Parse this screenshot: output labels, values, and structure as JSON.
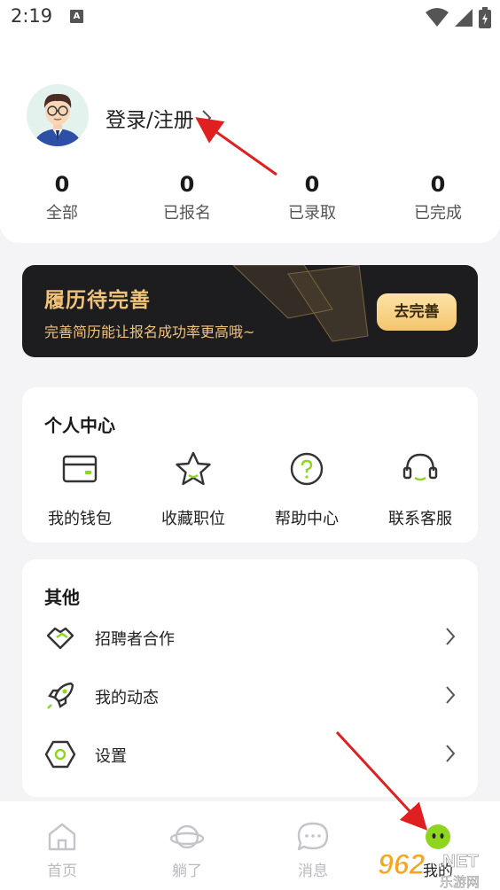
{
  "status_bar": {
    "time": "2:19",
    "app_badge": "A"
  },
  "profile": {
    "login_label": "登录/注册",
    "stats": [
      {
        "value": "0",
        "label": "全部"
      },
      {
        "value": "0",
        "label": "已报名"
      },
      {
        "value": "0",
        "label": "已录取"
      },
      {
        "value": "0",
        "label": "已完成"
      }
    ]
  },
  "resume_banner": {
    "title": "履历待完善",
    "subtitle": "完善简历能让报名成功率更高哦~",
    "button": "去完善"
  },
  "personal_center": {
    "heading": "个人中心",
    "items": [
      {
        "label": "我的钱包",
        "icon": "wallet-icon"
      },
      {
        "label": "收藏职位",
        "icon": "star-icon"
      },
      {
        "label": "帮助中心",
        "icon": "help-icon"
      },
      {
        "label": "联系客服",
        "icon": "headset-icon"
      }
    ]
  },
  "other": {
    "heading": "其他",
    "items": [
      {
        "label": "招聘者合作",
        "icon": "handshake-icon"
      },
      {
        "label": "我的动态",
        "icon": "rocket-icon"
      },
      {
        "label": "设置",
        "icon": "settings-hex-icon"
      }
    ]
  },
  "bottom_nav": {
    "items": [
      {
        "label": "首页",
        "icon": "home-icon",
        "active": false
      },
      {
        "label": "躺了",
        "icon": "planet-icon",
        "active": false
      },
      {
        "label": "消息",
        "icon": "chat-icon",
        "active": false
      },
      {
        "label": "我的",
        "icon": "smiley-icon",
        "active": true
      }
    ]
  },
  "colors": {
    "accent_green": "#8fd51e",
    "banner_gold": "#f1c27a",
    "banner_bg": "#1d1d1f"
  },
  "watermark": {
    "text_big": "962",
    "text_net": ".NET",
    "text_sub": "乐游网"
  }
}
